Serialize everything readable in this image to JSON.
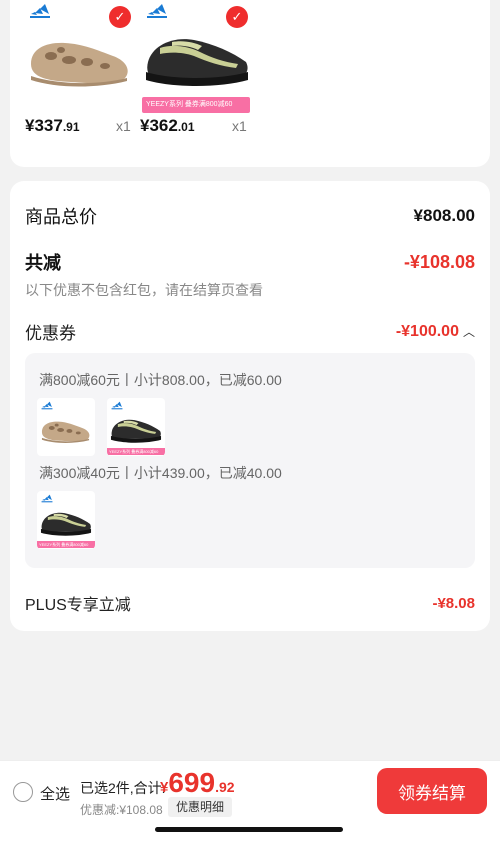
{
  "products": [
    {
      "brand_icon": "adidas-logo",
      "selected": true,
      "image": "foam-runner-shoe",
      "promo_tag": "",
      "price_int": "¥337",
      "price_dec": ".91",
      "qty": "x1"
    },
    {
      "brand_icon": "adidas-logo",
      "selected": true,
      "image": "yeezy-700-shoe",
      "promo_tag": "YEEZY系列 叠券满800减60",
      "price_int": "¥362",
      "price_dec": ".01",
      "qty": "x1"
    }
  ],
  "summary": {
    "total_label": "商品总价",
    "total_value": "¥808.00",
    "reduce_label": "共减",
    "reduce_value": "-¥108.08",
    "hint": "以下优惠不包含红包，请在结算页查看",
    "coupon_label": "优惠券",
    "coupon_value": "-¥100.00",
    "coupon_rules": [
      {
        "text": "满800减60元丨小计808.00，已减60.00"
      },
      {
        "text": "满300减40元丨小计439.00，已减40.00"
      }
    ],
    "plus_label": "PLUS专享立减",
    "plus_value": "-¥8.08"
  },
  "bottom": {
    "select_all": "全选",
    "selected_text": "已选2件,合计:",
    "price_currency": "¥",
    "price_int": "699",
    "price_dec": ".92",
    "discount_text": "优惠减:¥108.08",
    "detail_button": "优惠明细",
    "checkout_button": "领券结算"
  },
  "colors": {
    "accent": "#e8332c",
    "promo": "#f86fa4",
    "checkout": "#ef3a3a"
  }
}
